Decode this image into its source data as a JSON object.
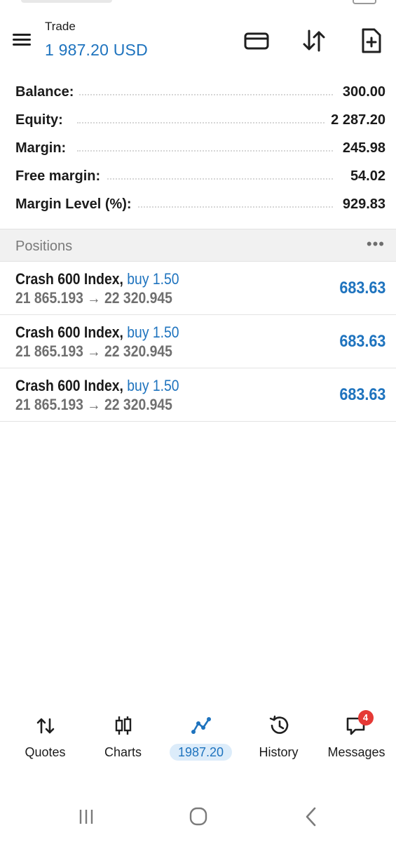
{
  "header": {
    "title": "Trade",
    "balance_display": "1 987.20 USD",
    "accent_color": "#1e73be",
    "icons": [
      "menu-icon",
      "card-icon",
      "sort-icon",
      "new-order-icon"
    ]
  },
  "summary": [
    {
      "label": "Balance:",
      "value": "300.00"
    },
    {
      "label": "Equity:",
      "value": "2 287.20"
    },
    {
      "label": "Margin:",
      "value": "245.98"
    },
    {
      "label": "Free margin:",
      "value": "54.02"
    },
    {
      "label": "Margin Level (%):",
      "value": "929.83"
    }
  ],
  "positions_section": {
    "title": "Positions",
    "more": "•••"
  },
  "positions": [
    {
      "symbol": "Crash 600 Index,",
      "side": "buy 1.50",
      "prices": "21 865.193 → 22 320.945",
      "profit": "683.63"
    },
    {
      "symbol": "Crash 600 Index,",
      "side": "buy 1.50",
      "prices": "21 865.193 → 22 320.945",
      "profit": "683.63"
    },
    {
      "symbol": "Crash 600 Index,",
      "side": "buy 1.50",
      "prices": "21 865.193 → 22 320.945",
      "profit": "683.63"
    }
  ],
  "bottom_nav": [
    {
      "label": "Quotes",
      "icon": "quotes-icon"
    },
    {
      "label": "Charts",
      "icon": "charts-icon"
    },
    {
      "label": "1987.20",
      "icon": "trade-icon",
      "active": true
    },
    {
      "label": "History",
      "icon": "history-icon"
    },
    {
      "label": "Messages",
      "icon": "messages-icon",
      "badge": "4"
    }
  ]
}
